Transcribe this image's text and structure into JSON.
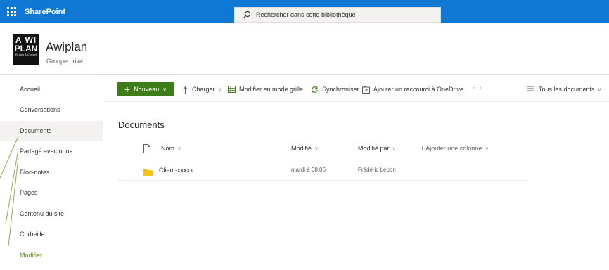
{
  "suitebar": {
    "app_name": "SharePoint",
    "search_placeholder": "Rechercher dans cette bibliothèque",
    "icons": [
      "waffle-icon",
      "search-icon"
    ]
  },
  "site": {
    "logo_lines": [
      "A WI",
      "PLAN",
      "Etudes & Conseil"
    ],
    "title": "Awiplan",
    "subtitle": "Groupe privé"
  },
  "leftnav": {
    "items": [
      {
        "label": "Accueil"
      },
      {
        "label": "Conversations"
      },
      {
        "label": "Documents",
        "active": true
      },
      {
        "label": "Partagé avec nous"
      },
      {
        "label": "Bloc-notes"
      },
      {
        "label": "Pages"
      },
      {
        "label": "Contenu du site"
      },
      {
        "label": "Corbeille"
      },
      {
        "label": "Modifier"
      }
    ]
  },
  "commandbar": {
    "new_label": "Nouveau",
    "upload_label": "Charger",
    "grid_label": "Modifier en mode grille",
    "sync_label": "Synchroniser",
    "shortcut_label": "Ajouter un raccourci à OneDrive",
    "more_label": "···",
    "view_label": "Tous les documents",
    "accent_color": "#3e7c18"
  },
  "library": {
    "title": "Documents",
    "columns": {
      "name": "Nom",
      "modified": "Modifié",
      "modified_by": "Modifié par",
      "add_column": "+ Ajouter une colonne"
    },
    "rows": [
      {
        "name": "Client-xxxxx",
        "modified": "mardi à 08:06",
        "modified_by": "Frédéric Lebon",
        "icon": "folder-icon"
      }
    ]
  },
  "colors": {
    "suitebar": "#0f78d4",
    "folder": "#f0b800",
    "edit_link": "#5d8a1c"
  }
}
